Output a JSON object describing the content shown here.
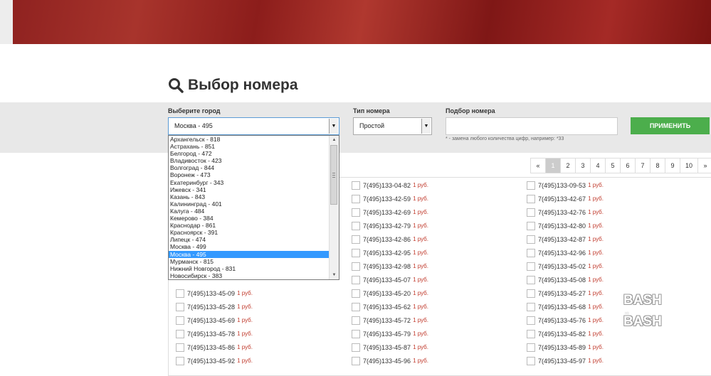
{
  "page_title": "Выбор номера",
  "filters": {
    "city_label": "Выберите город",
    "city_value": "Москва - 495",
    "type_label": "Тип номера",
    "type_value": "Простой",
    "pick_label": "Подбор номера",
    "pick_value": "",
    "hint": "* - замена любого количества цифр, например: *33",
    "apply_label": "ПРИМЕНИТЬ"
  },
  "city_options": [
    "Архангельск - 818",
    "Астрахань - 851",
    "Белгород - 472",
    "Владивосток - 423",
    "Волгоград - 844",
    "Воронеж - 473",
    "Екатеринбург - 343",
    "Ижевск - 341",
    "Казань - 843",
    "Калининград - 401",
    "Калуга - 484",
    "Кемерово - 384",
    "Краснодар - 861",
    "Красноярск - 391",
    "Липецк - 474",
    "Москва - 499",
    "Москва - 495",
    "Мурманск - 815",
    "Нижний Новгород - 831",
    "Новосибирск - 383"
  ],
  "selected_city_index": 16,
  "pagination": {
    "prev": "«",
    "pages": [
      "1",
      "2",
      "3",
      "4",
      "5",
      "6",
      "7",
      "8",
      "9",
      "10"
    ],
    "next": "»",
    "active": "1"
  },
  "price_label": "1 руб.",
  "numbers": {
    "col1": [
      "7(495)133-45-09",
      "7(495)133-45-28",
      "7(495)133-45-69",
      "7(495)133-45-78",
      "7(495)133-45-86",
      "7(495)133-45-92"
    ],
    "col2": [
      "7(495)133-04-82",
      "7(495)133-42-59",
      "7(495)133-42-69",
      "7(495)133-42-79",
      "7(495)133-42-86",
      "7(495)133-42-95",
      "7(495)133-42-98",
      "7(495)133-45-07",
      "7(495)133-45-20",
      "7(495)133-45-62",
      "7(495)133-45-72",
      "7(495)133-45-79",
      "7(495)133-45-87",
      "7(495)133-45-96"
    ],
    "col3": [
      "7(495)133-09-53",
      "7(495)133-42-67",
      "7(495)133-42-76",
      "7(495)133-42-80",
      "7(495)133-42-87",
      "7(495)133-42-96",
      "7(495)133-45-02",
      "7(495)133-45-08",
      "7(495)133-45-27",
      "7(495)133-45-68",
      "7(495)133-45-76",
      "7(495)133-45-82",
      "7(495)133-45-89",
      "7(495)133-45-97"
    ]
  },
  "watermark": {
    "line1": "BASH",
    "small": "на",
    "line2": "BASH"
  },
  "icons": {
    "title": "search-icon"
  }
}
